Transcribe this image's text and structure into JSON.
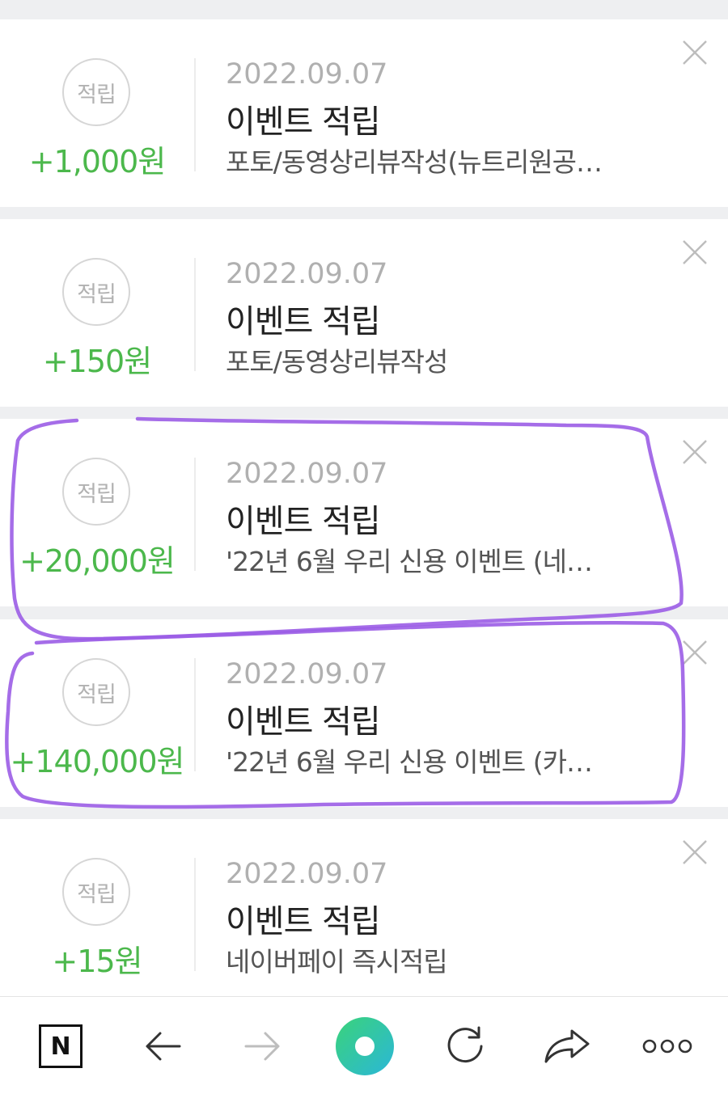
{
  "items": [
    {
      "badge": "적립",
      "amount": "+1,000원",
      "date": "2022.09.07",
      "title": "이벤트 적립",
      "desc": "포토/동영상리뷰작성(뉴트리원공…"
    },
    {
      "badge": "적립",
      "amount": "+150원",
      "date": "2022.09.07",
      "title": "이벤트 적립",
      "desc": "포토/동영상리뷰작성"
    },
    {
      "badge": "적립",
      "amount": "+20,000원",
      "date": "2022.09.07",
      "title": "이벤트 적립",
      "desc": "'22년 6월 우리 신용 이벤트 (네…"
    },
    {
      "badge": "적립",
      "amount": "+140,000원",
      "date": "2022.09.07",
      "title": "이벤트 적립",
      "desc": "'22년 6월 우리 신용 이벤트 (카…"
    },
    {
      "badge": "적립",
      "amount": "+15원",
      "date": "2022.09.07",
      "title": "이벤트 적립",
      "desc": "네이버페이 즉시적립"
    }
  ],
  "toolbar": {
    "home_icon_letter": "N",
    "icons": [
      "naver-home-icon",
      "back-arrow-icon",
      "forward-arrow-icon",
      "green-dot-icon",
      "refresh-icon",
      "share-icon",
      "more-icon"
    ]
  },
  "colors": {
    "amount": "#4cb84c",
    "annotation": "#9b5de5",
    "green_dot_gradient": [
      "#3ad37a",
      "#2bb7d8"
    ]
  }
}
